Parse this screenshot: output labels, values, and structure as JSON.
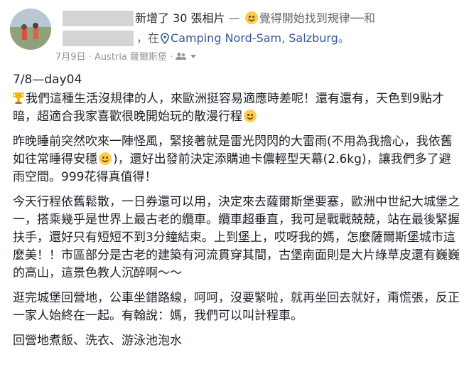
{
  "header": {
    "action_text": "新增了 30 張相片",
    "separator": " — ",
    "feeling_text": "覺得開始找到規律──和",
    "at_text": "，在",
    "place": "Camping Nord-Sam, Salzburg",
    "period": "。"
  },
  "meta": {
    "date": "7月9日",
    "dot": "·",
    "location": "Austria 薩爾斯堡",
    "dot2": "·"
  },
  "post": {
    "title": "7/8—day04",
    "p1": "我們這種生活沒規律的人，來歐洲挺容易適應時差呢！還有還有，天色到9點才暗，超適合我家喜歡很晚開始玩的散漫行程",
    "p2a": "昨晚睡前突然吹來一陣怪風，緊接著就是雷光閃閃的大雷雨(不用為我擔心，我依舊如往常睡得安穩",
    "p2b": ")，還好出發前決定添購迪卡儂輕型天幕(2.6kg)，讓我們多了避雨空間。999花得真值得！",
    "p3": "今天行程依舊鬆散，一日券還可以用，決定來去薩爾斯堡要塞，歐洲中世紀大城堡之一，搭乘幾乎是世界上最古老的纜車。纜車超垂直，我可是戰戰兢兢，站在最後緊握扶手，還好只有短短不到3分鐘結束。上到堡上，哎呀我的媽，怎麼薩爾斯堡城市這麼美！！市區部分是古老的建築有河流貫穿其間，古堡南面則是大片綠草皮還有巍巍的高山，這景色教人沉醉啊～～",
    "p4": "逛完城堡回營地，公車坐錯路線，呵呵，沒要緊啦，就再坐回去就好，甭慌張，反正一家人始終在一起。有翰說：媽，我們可以叫計程車。",
    "p5": "回營地煮飯、洗衣、游泳池泡水"
  }
}
